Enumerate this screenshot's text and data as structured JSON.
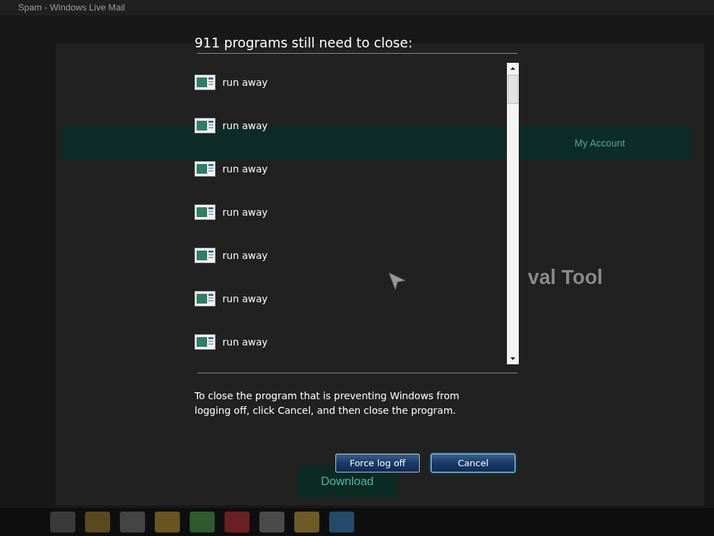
{
  "background": {
    "window_title": "Spam - Windows Live Mail",
    "account_label": "My Account",
    "heading": "val Tool",
    "download_button": "Download"
  },
  "dialog": {
    "title": "911 programs still need to close:",
    "programs": [
      {
        "name": "run away"
      },
      {
        "name": "run away"
      },
      {
        "name": "run away"
      },
      {
        "name": "run away"
      },
      {
        "name": "run away"
      },
      {
        "name": "run away"
      },
      {
        "name": "run away"
      }
    ],
    "message": "To close the program that is preventing Windows from logging off, click Cancel, and then close the program.",
    "buttons": [
      {
        "label": "Force log off",
        "focused": false
      },
      {
        "label": "Cancel",
        "focused": true
      }
    ]
  }
}
